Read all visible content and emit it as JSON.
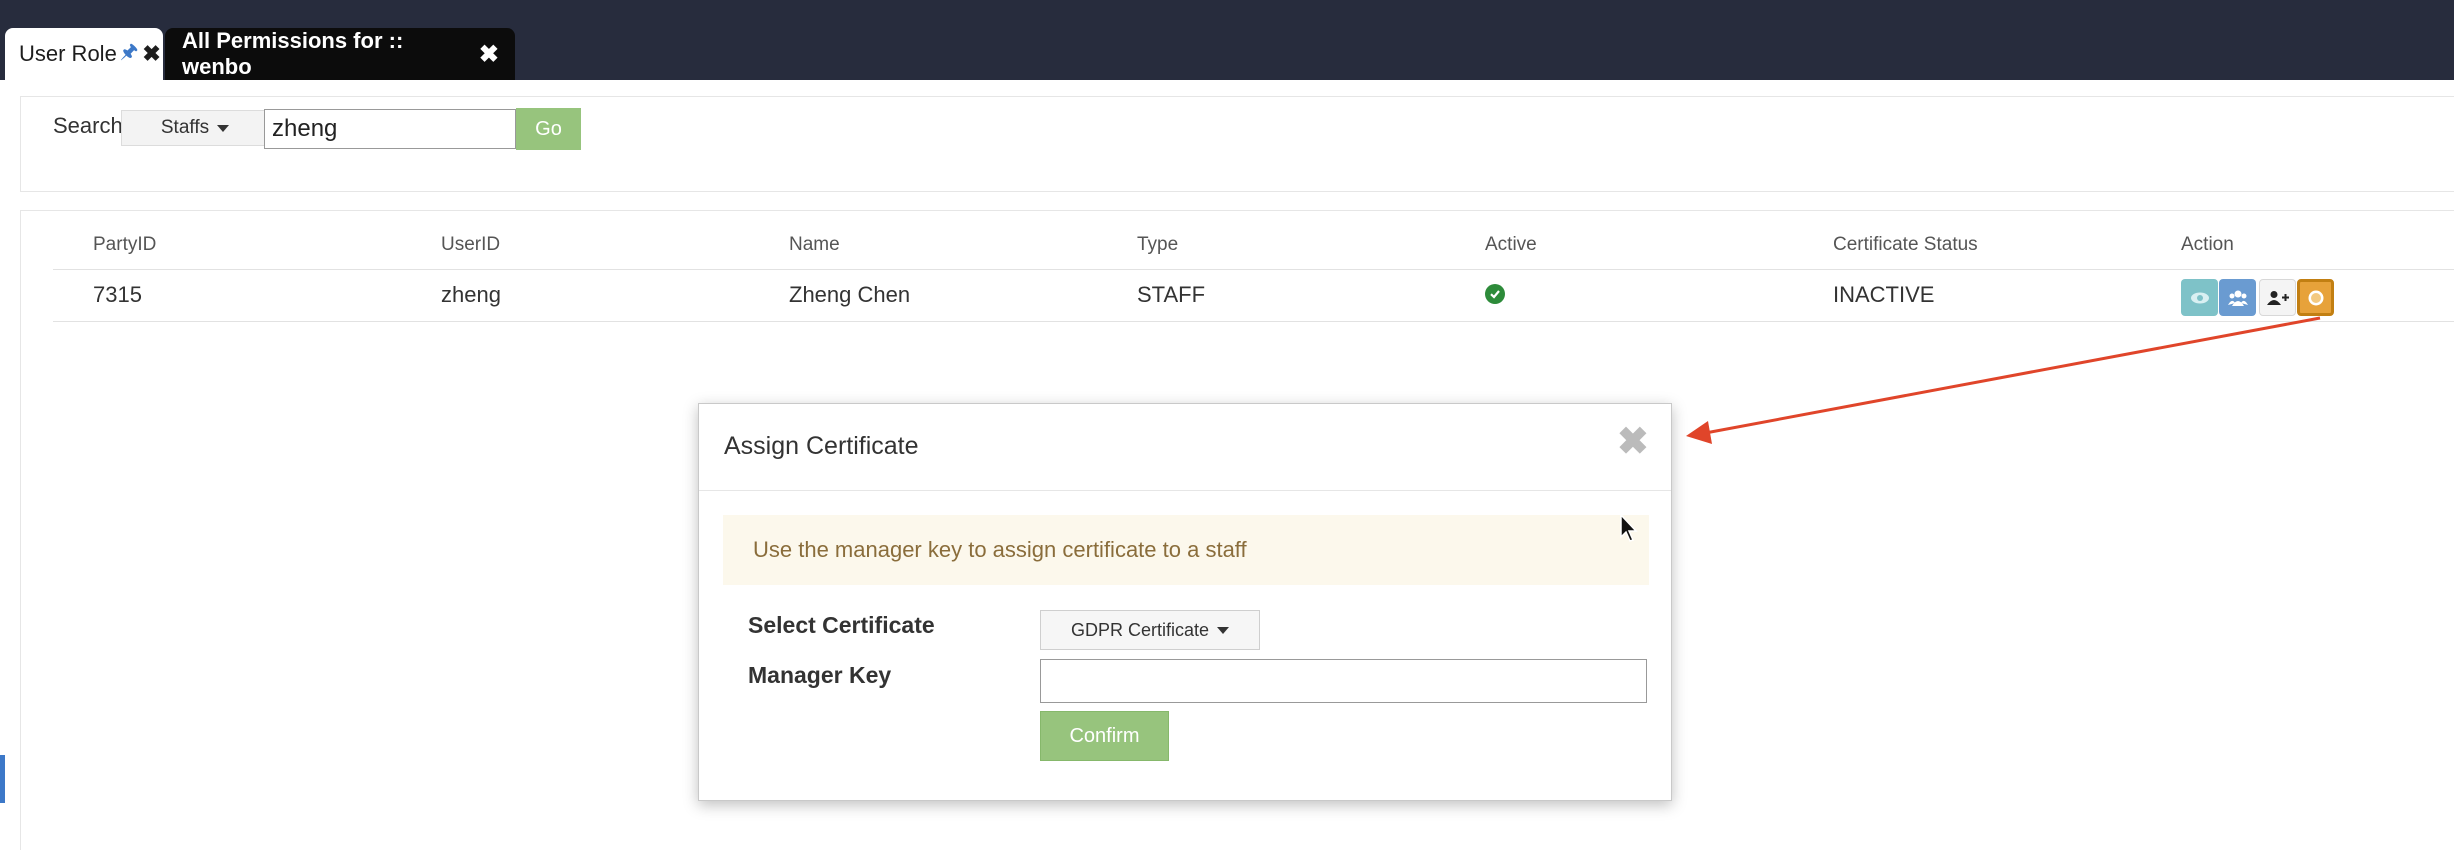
{
  "tabs": [
    {
      "label": "User Role",
      "pinned": true,
      "active": true
    },
    {
      "label": "All Permissions for :: wenbo",
      "active": false
    }
  ],
  "search": {
    "label": "Search",
    "filter": "Staffs",
    "value": "zheng",
    "go_label": "Go"
  },
  "table": {
    "columns": [
      "PartyID",
      "UserID",
      "Name",
      "Type",
      "Active",
      "Certificate Status",
      "Action"
    ],
    "rows": [
      {
        "party_id": "7315",
        "user_id": "zheng",
        "name": "Zheng Chen",
        "type": "STAFF",
        "active": true,
        "certificate_status": "INACTIVE"
      }
    ],
    "actions": [
      "eye-icon",
      "users-icon",
      "add-user-icon",
      "certificate-icon"
    ]
  },
  "modal": {
    "title": "Assign Certificate",
    "close_symbol": "✖",
    "alert_text": "Use the manager key to assign certificate to a staff",
    "select_label": "Select Certificate",
    "select_value": "GDPR Certificate",
    "key_label": "Manager Key",
    "key_value": "",
    "confirm_label": "Confirm"
  },
  "colors": {
    "topbar": "#272c3d",
    "go_button": "#97c47d",
    "alert_bg": "#fcf8ec",
    "alert_text": "#8a6d3b",
    "annotation_arrow": "#e0452a",
    "active_check": "#2d8b3a"
  }
}
